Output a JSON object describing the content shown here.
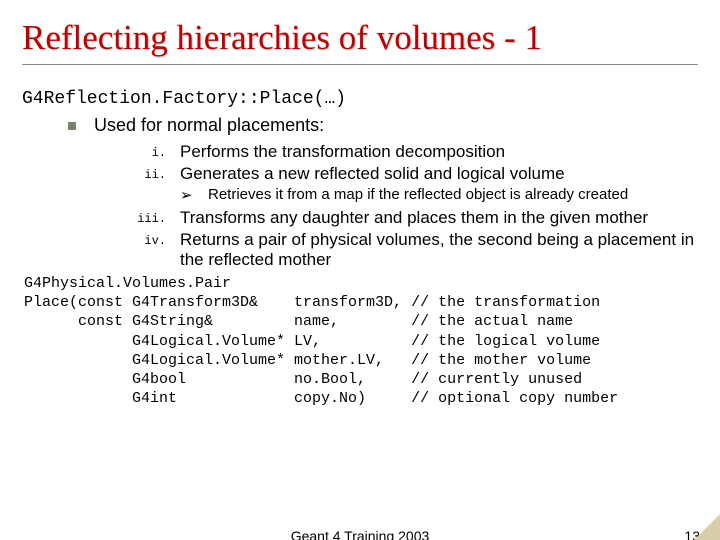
{
  "title": "Reflecting hierarchies of volumes - 1",
  "subhead": "G4Reflection.Factory::Place(…)",
  "lvl1": "Used for normal placements:",
  "roman": [
    {
      "n": "i.",
      "t": "Performs the transformation decomposition"
    },
    {
      "n": "ii.",
      "t": "Generates a new reflected solid and logical volume"
    },
    {
      "n": "iii.",
      "t": "Transforms any daughter and places them in the given mother"
    },
    {
      "n": "iv.",
      "t": "Returns a pair of physical volumes, the second being a placement in the reflected mother"
    }
  ],
  "subarrow": {
    "glyph": "➢",
    "t": "Retrieves it from a map if the reflected object is already created"
  },
  "code": "G4Physical.Volumes.Pair\nPlace(const G4Transform3D&    transform3D, // the transformation\n      const G4String&         name,        // the actual name\n            G4Logical.Volume* LV,          // the logical volume\n            G4Logical.Volume* mother.LV,   // the mother volume\n            G4bool            no.Bool,     // currently unused\n            G4int             copy.No)     // optional copy number",
  "footer": {
    "center": "Geant 4 Training 2003",
    "page": "13"
  }
}
